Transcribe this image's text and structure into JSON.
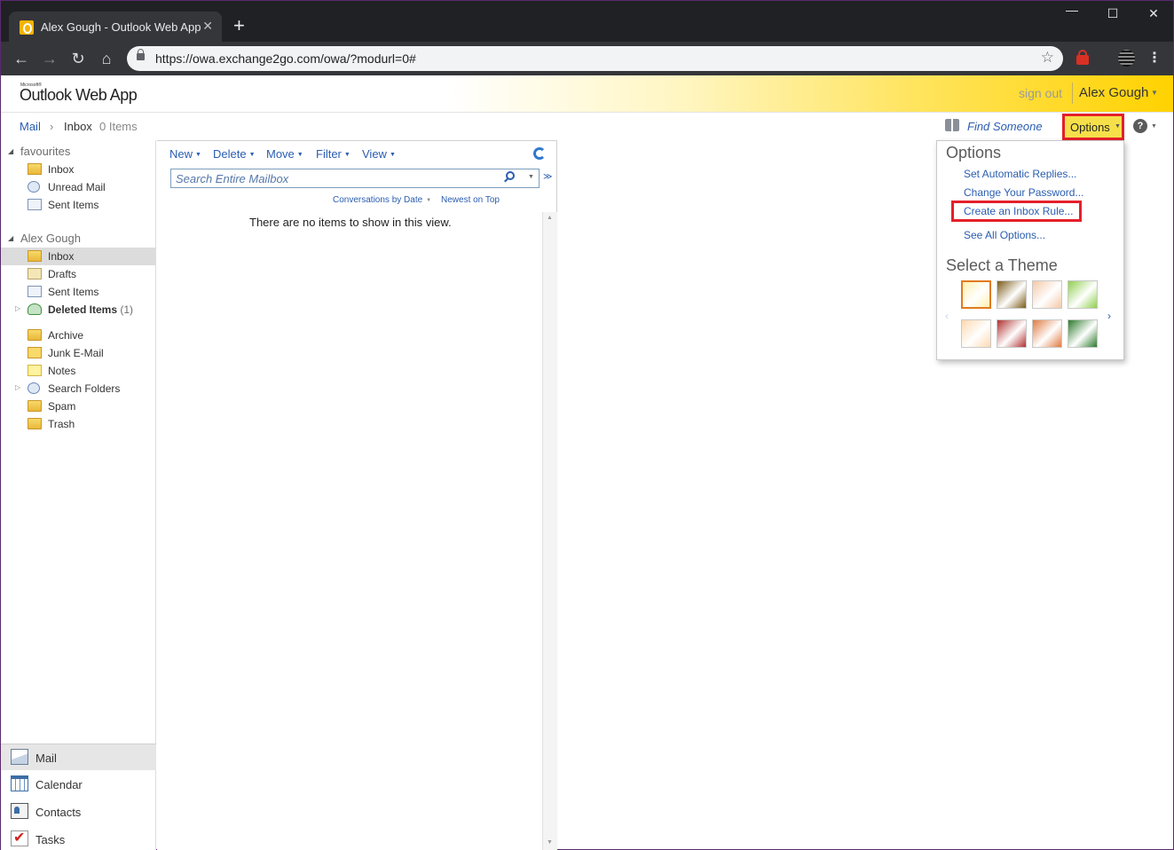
{
  "browser": {
    "tab_title": "Alex Gough - Outlook Web App",
    "url": "https://owa.exchange2go.com/owa/?modurl=0#"
  },
  "header": {
    "brand_small": "Microsoft®",
    "brand": "Outlook Web App",
    "sign_out": "sign out",
    "user_name": "Alex Gough"
  },
  "breadcrumb": {
    "root": "Mail",
    "folder": "Inbox",
    "count": "0 Items"
  },
  "toolbar_right": {
    "find_someone": "Find Someone",
    "options": "Options",
    "help": "?"
  },
  "nav": {
    "favourites_label": "favourites",
    "favourites": [
      {
        "label": "Inbox"
      },
      {
        "label": "Unread Mail"
      },
      {
        "label": "Sent Items"
      }
    ],
    "mailbox_label": "Alex Gough",
    "folders": [
      {
        "label": "Inbox"
      },
      {
        "label": "Drafts"
      },
      {
        "label": "Sent Items"
      },
      {
        "label": "Deleted Items",
        "count": "(1)"
      },
      {
        "label": "Archive"
      },
      {
        "label": "Junk E-Mail"
      },
      {
        "label": "Notes"
      },
      {
        "label": "Search Folders"
      },
      {
        "label": "Spam"
      },
      {
        "label": "Trash"
      }
    ],
    "apps": [
      {
        "label": "Mail"
      },
      {
        "label": "Calendar"
      },
      {
        "label": "Contacts"
      },
      {
        "label": "Tasks"
      }
    ]
  },
  "list": {
    "toolbar": [
      "New",
      "Delete",
      "Move",
      "Filter",
      "View"
    ],
    "search_placeholder": "Search Entire Mailbox",
    "sort_by": "Conversations by Date",
    "sort_order": "Newest on Top",
    "empty_message": "There are no items to show in this view."
  },
  "options_menu": {
    "title": "Options",
    "links": [
      "Set Automatic Replies...",
      "Change Your Password...",
      "Create an Inbox Rule...",
      "See All Options..."
    ],
    "theme_title": "Select a Theme",
    "themes": [
      "#fff0b0",
      "#7a5a18",
      "#f3c9a8",
      "#8fcf4e",
      "#ffd9b0",
      "#b03030",
      "#e07a40",
      "#2a7a2a"
    ]
  },
  "colors": {
    "accent_yellow": "#ffd200",
    "link_blue": "#2a5db0",
    "highlight_red": "#e4202a"
  }
}
